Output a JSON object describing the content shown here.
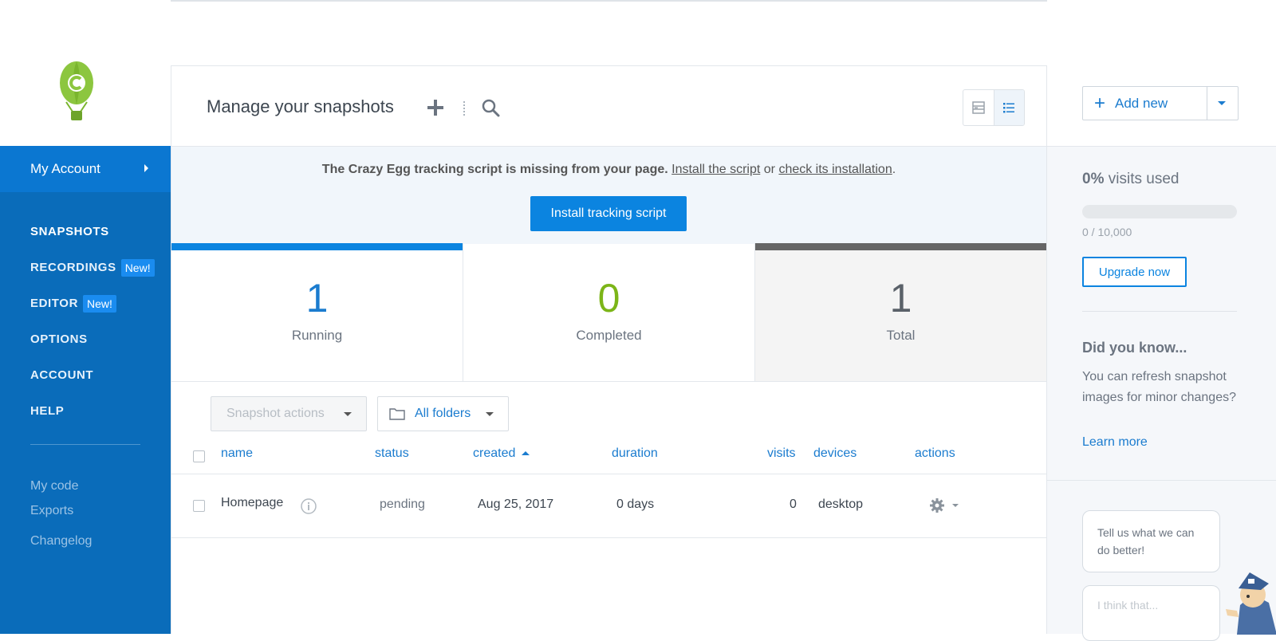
{
  "app": {
    "brand_color": "#0b84e0",
    "sidebar_color": "#0a6cba"
  },
  "sidebar": {
    "account_label": "My Account",
    "nav": [
      {
        "label": "SNAPSHOTS",
        "badge": ""
      },
      {
        "label": "RECORDINGS",
        "badge": "New!"
      },
      {
        "label": "EDITOR",
        "badge": "New!"
      },
      {
        "label": "OPTIONS",
        "badge": ""
      },
      {
        "label": "ACCOUNT",
        "badge": ""
      },
      {
        "label": "HELP",
        "badge": ""
      }
    ],
    "sub_nav": [
      "My code",
      "Exports",
      "Changelog"
    ]
  },
  "header": {
    "title": "Manage your snapshots",
    "icons": [
      "plus-icon",
      "search-icon",
      "grid-view-icon",
      "list-view-icon"
    ]
  },
  "alert": {
    "message": "The Crazy Egg tracking script is missing from your page.",
    "link1": "Install the script",
    "connector": "or",
    "link2": "check its installation",
    "end": ".",
    "button": "Install tracking script"
  },
  "stats": [
    {
      "value": "1",
      "label": "Running",
      "color": "#1b7ccf",
      "bar": "#0b84e0"
    },
    {
      "value": "0",
      "label": "Completed",
      "color": "#7cb518",
      "bar": ""
    },
    {
      "value": "1",
      "label": "Total",
      "color": "#5a6169",
      "bar": "#666666"
    }
  ],
  "toolbar": {
    "actions_placeholder": "Snapshot actions",
    "folders_label": "All folders"
  },
  "table": {
    "columns": [
      "name",
      "status",
      "created",
      "duration",
      "visits",
      "devices",
      "actions"
    ],
    "rows": [
      {
        "name": "Homepage",
        "status": "pending",
        "created": "Aug 25, 2017",
        "duration": "0 days",
        "visits": "0",
        "devices": "desktop"
      }
    ]
  },
  "right": {
    "add_new": "Add new",
    "usage_percent": "0%",
    "usage_text": "visits used",
    "usage_fraction": 0,
    "usage_count": "0 / 10,000",
    "upgrade": "Upgrade now",
    "dyk_title": "Did you know...",
    "dyk_text": "You can refresh snapshot images for minor changes?",
    "learn_more": "Learn more",
    "feedback_prompt": "Tell us what we can do better!",
    "feedback_placeholder": "I think that..."
  }
}
